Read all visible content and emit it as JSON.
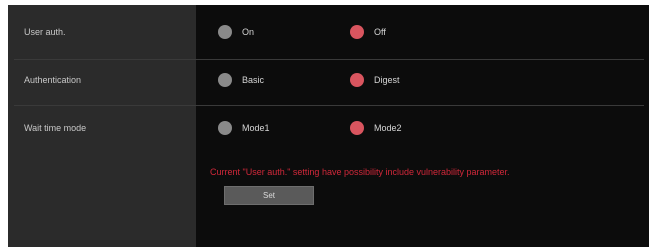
{
  "settings": {
    "user_auth": {
      "label": "User auth.",
      "options": [
        "On",
        "Off"
      ],
      "selected": "Off"
    },
    "authentication": {
      "label": "Authentication",
      "options": [
        "Basic",
        "Digest"
      ],
      "selected": "Digest"
    },
    "wait_time_mode": {
      "label": "Wait time mode",
      "options": [
        "Mode1",
        "Mode2"
      ],
      "selected": "Mode2"
    }
  },
  "warning_text": "Current \"User auth.\" setting have possibility include vulnerability parameter.",
  "set_button_label": "Set",
  "colors": {
    "selected_radio": "#d9555f",
    "unselected_radio": "#8a8a8a",
    "warning": "#d2283a",
    "panel_bg": "#0c0c0c",
    "label_bg": "#2b2b2b"
  }
}
